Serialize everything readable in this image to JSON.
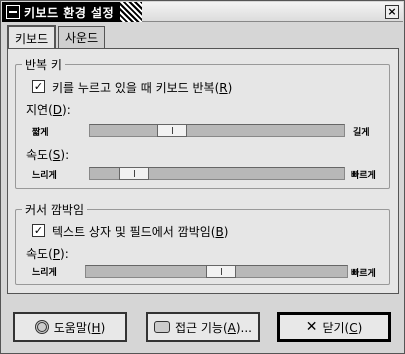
{
  "window": {
    "title": "키보드 환경 설정",
    "close_glyph": "×"
  },
  "tabs": [
    {
      "label": "키보드",
      "active": true
    },
    {
      "label": "사운드",
      "active": false
    }
  ],
  "repeat_section": {
    "title": "반복 키",
    "checkbox_label_pre": "키를 누르고 있을 때 키보드 반복(",
    "checkbox_mnemonic": "R",
    "checkbox_label_post": ")",
    "checked": true,
    "delay": {
      "label_pre": "지연(",
      "mnemonic": "D",
      "label_post": "):",
      "left": "짧게",
      "right": "길게",
      "value": 0.3
    },
    "speed": {
      "label_pre": "속도(",
      "mnemonic": "S",
      "label_post": "):",
      "left": "느리게",
      "right": "빠르게",
      "value": 0.13
    }
  },
  "cursor_section": {
    "title": "커서 깜박임",
    "checkbox_label_pre": "텍스트 상자 및 필드에서 깜박임(",
    "checkbox_mnemonic": "B",
    "checkbox_label_post": ")",
    "checked": true,
    "speed": {
      "label_pre": "속도(",
      "mnemonic": "P",
      "label_post": "):",
      "left": "느리게",
      "right": "빠르게",
      "value": 0.52
    }
  },
  "buttons": {
    "help_pre": "도움말(",
    "help_mn": "H",
    "help_post": ")",
    "access_pre": "접근 기능(",
    "access_mn": "A",
    "access_post": ")...",
    "close_pre": "닫기(",
    "close_mn": "C",
    "close_post": ")"
  },
  "icons": {
    "check": "✓",
    "close": "✕"
  }
}
